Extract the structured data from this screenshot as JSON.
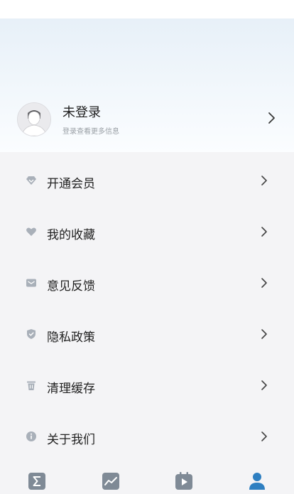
{
  "profile": {
    "name": "未登录",
    "subtitle": "登录查看更多信息"
  },
  "menu": [
    {
      "label": "开通会员",
      "icon": "diamond-icon"
    },
    {
      "label": "我的收藏",
      "icon": "heart-icon"
    },
    {
      "label": "意见反馈",
      "icon": "mail-icon"
    },
    {
      "label": "隐私政策",
      "icon": "shield-icon"
    },
    {
      "label": "清理缓存",
      "icon": "trash-icon"
    },
    {
      "label": "关于我们",
      "icon": "info-icon"
    }
  ],
  "tabbar": [
    {
      "icon": "sigma-icon",
      "active": false
    },
    {
      "icon": "trend-chart-icon",
      "active": false
    },
    {
      "icon": "calendar-play-icon",
      "active": false
    },
    {
      "icon": "user-icon",
      "active": true
    }
  ],
  "colors": {
    "icon_gray": "#a9b0b9",
    "tab_inactive": "#7f8a96",
    "tab_active": "#2e7fc1",
    "header_gradient_top": "#e7f0f8"
  }
}
